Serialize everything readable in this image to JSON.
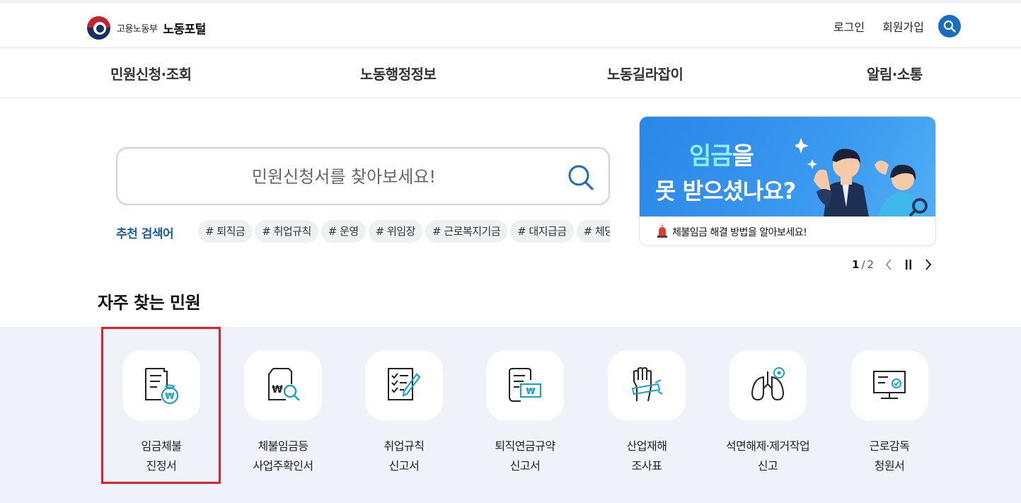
{
  "header": {
    "logo_sub": "고용노동부",
    "logo_main": "노동포털",
    "login": "로그인",
    "signup": "회원가입",
    "search_icon": "search-icon"
  },
  "nav": {
    "items": [
      "민원신청·조회",
      "노동행정정보",
      "노동길라잡이",
      "알림·소통"
    ]
  },
  "search": {
    "placeholder": "민원신청서를 찾아보세요!",
    "value": "",
    "recommended_label": "추천 검색어",
    "tags": [
      "# 퇴직금",
      "# 취업규칙",
      "# 운영",
      "# 위임장",
      "# 근로복지기금",
      "# 대지급금",
      "# 체당금"
    ]
  },
  "banner": {
    "title_highlight": "임금",
    "title_rest": "을",
    "title_line2": "못 받으셨나요?",
    "caption": "체불임금 해결 방법을 알아보세요!",
    "page_current": "1",
    "page_sep": "/",
    "page_total": "2",
    "colors": {
      "bg": "#3a99f0",
      "highlight": "#8ff0ff"
    }
  },
  "frequent": {
    "title": "자주 찾는 민원",
    "items": [
      {
        "line1": "임금체불",
        "line2": "진정서",
        "icon": "wage-document-icon"
      },
      {
        "line1": "체불임금등",
        "line2": "사업주확인서",
        "icon": "document-search-icon"
      },
      {
        "line1": "취업규칙",
        "line2": "신고서",
        "icon": "checklist-pen-icon"
      },
      {
        "line1": "퇴직연금규약",
        "line2": "신고서",
        "icon": "scroll-money-icon"
      },
      {
        "line1": "산업재해",
        "line2": "조사표",
        "icon": "injured-hand-icon"
      },
      {
        "line1": "석면해제·제거작업",
        "line2": "신고",
        "icon": "lungs-icon"
      },
      {
        "line1": "근로감독",
        "line2": "청원서",
        "icon": "monitor-check-icon"
      }
    ]
  }
}
